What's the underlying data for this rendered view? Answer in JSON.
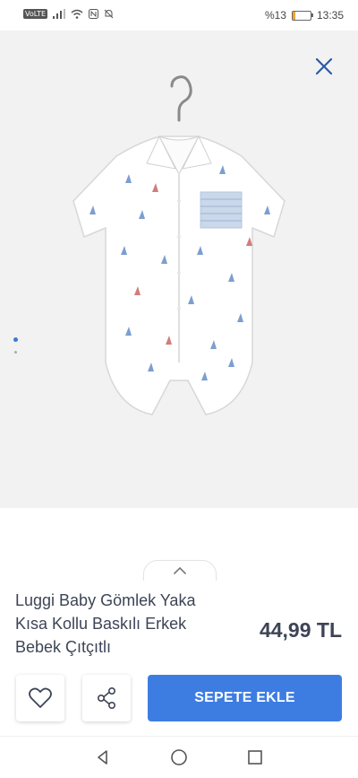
{
  "status_bar": {
    "volte": "VoLTE",
    "battery_text": "%13",
    "battery_level": 0.13,
    "time": "13:35"
  },
  "product": {
    "title": "Luggi Baby Gömlek Yaka Kısa Kollu Baskılı Erkek Bebek Çıtçıtlı",
    "price": "44,99 TL",
    "gallery": {
      "total_images": 2,
      "current_index": 0
    }
  },
  "actions": {
    "favorite_icon": "heart-icon",
    "share_icon": "share-icon",
    "add_to_cart_label": "SEPETE EKLE"
  },
  "colors": {
    "accent": "#3d7de2",
    "dot_active": "#3b79d8",
    "close_icon": "#2d5aa8",
    "text": "#3d4455",
    "hero_bg": "#f2f2f2"
  }
}
